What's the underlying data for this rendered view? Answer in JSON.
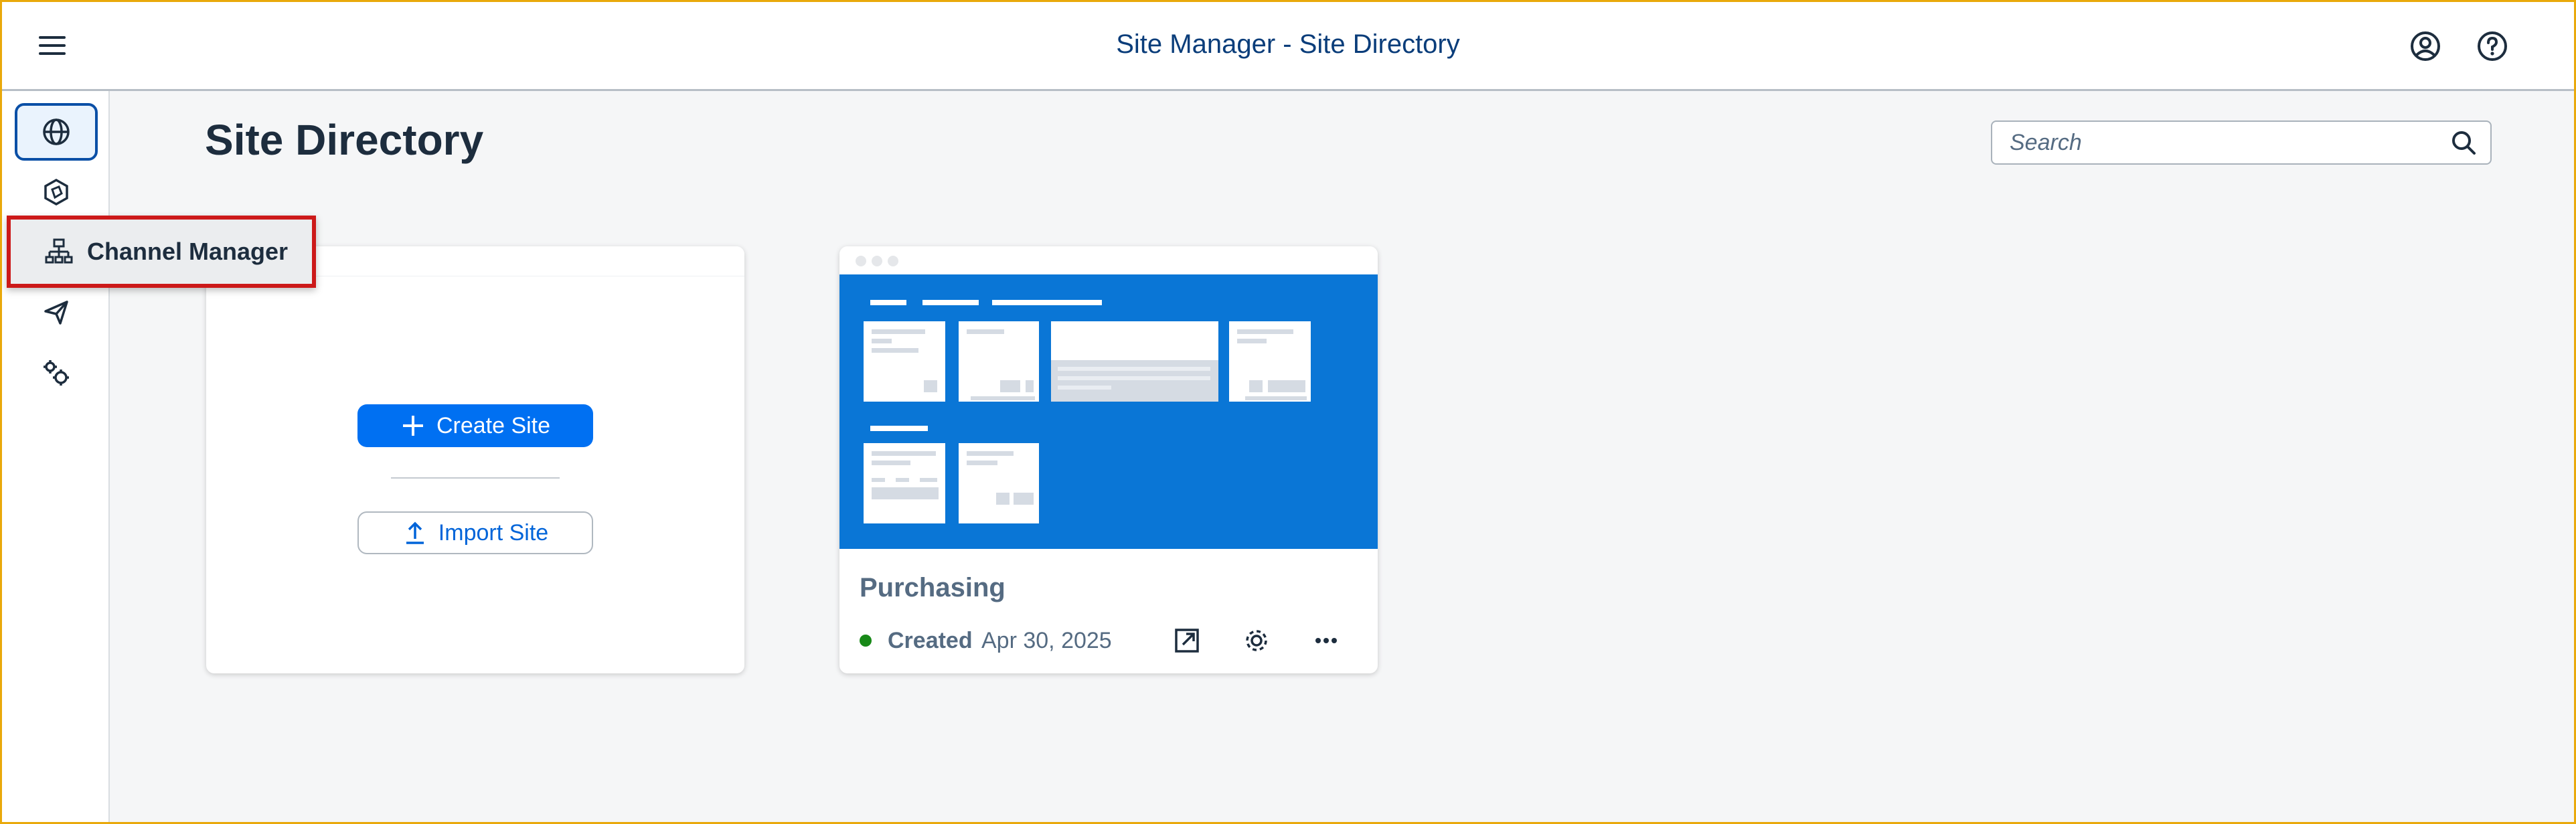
{
  "header": {
    "title": "Site Manager - Site Directory",
    "menu_icon": "hamburger-menu-icon",
    "profile_icon": "user-profile-icon",
    "help_icon": "help-icon"
  },
  "sidenav": {
    "items": [
      {
        "icon": "globe-icon",
        "active": true
      },
      {
        "icon": "hexagon-icon"
      },
      {
        "icon": "hierarchy-icon",
        "label": "Channel Manager"
      },
      {
        "icon": "paper-plane-icon"
      },
      {
        "icon": "gears-icon"
      }
    ],
    "popover_label": "Channel Manager"
  },
  "page": {
    "title": "Site Directory",
    "search_placeholder": "Search"
  },
  "create_card": {
    "create_label": "Create Site",
    "import_label": "Import Site"
  },
  "site_card": {
    "name": "Purchasing",
    "status": "Created",
    "date": "Apr 30, 2025",
    "status_color": "#188918"
  },
  "colors": {
    "accent": "#0070f2",
    "brand_text": "#0a3d7a",
    "thumbnail_bg": "#0a76d6",
    "highlight_border": "#cc1919"
  }
}
